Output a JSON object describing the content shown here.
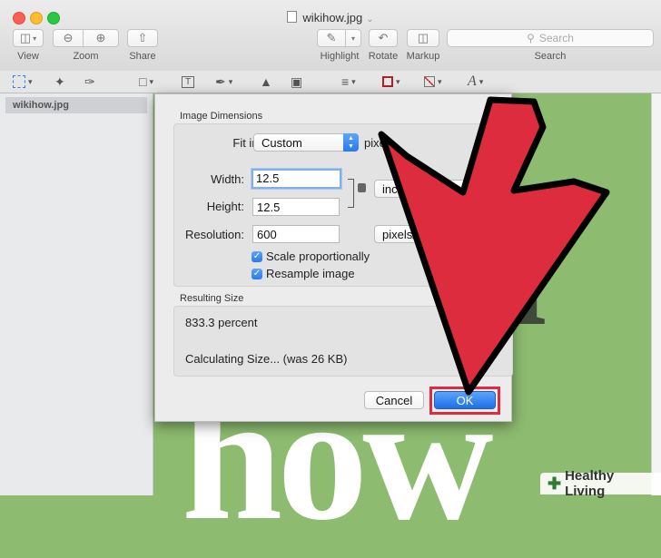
{
  "window": {
    "title": "wikihow.jpg"
  },
  "toolbar": {
    "view_label": "View",
    "zoom_label": "Zoom",
    "share_label": "Share",
    "highlight_label": "Highlight",
    "rotate_label": "Rotate",
    "markup_label": "Markup",
    "search_placeholder": "Search",
    "search_label": "Search"
  },
  "sidebar": {
    "items": [
      {
        "label": "wikihow.jpg"
      }
    ]
  },
  "dialog": {
    "image_dimensions_label": "Image Dimensions",
    "fit_into_label": "Fit into:",
    "fit_into_value": "Custom",
    "fit_into_unit": "pixels",
    "width_label": "Width:",
    "width_value": "12.5",
    "height_label": "Height:",
    "height_value": "12.5",
    "dimension_unit": "inches",
    "resolution_label": "Resolution:",
    "resolution_value": "600",
    "resolution_unit": "pixels/inch",
    "scale_proportionally_label": "Scale proportionally",
    "scale_proportionally_checked": true,
    "resample_image_label": "Resample image",
    "resample_image_checked": true,
    "resulting_size_label": "Resulting Size",
    "percent_text": "833.3 percent",
    "calculating_text": "Calculating Size... (was 26 KB)",
    "cancel_label": "Cancel",
    "ok_label": "OK"
  },
  "background": {
    "big_text": "how",
    "side_text": "i"
  },
  "watermark": {
    "text": "Healthy Living"
  },
  "colors": {
    "arrow_red": "#dc2c3d",
    "canvas_green": "#8dbb6f",
    "accent_blue": "#2b79ed"
  }
}
